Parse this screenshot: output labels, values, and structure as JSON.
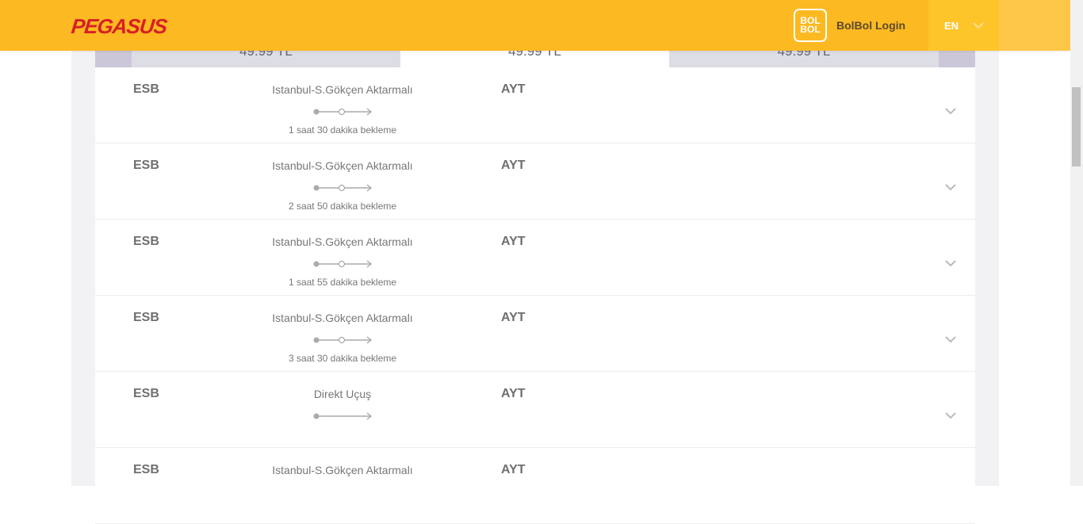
{
  "header": {
    "logo_text": "PEGASUS",
    "bolbol_badge": [
      "BOL",
      "BOL"
    ],
    "bolbol_login": "BolBol Login",
    "language": "EN"
  },
  "price_tabs": [
    {
      "price": "49.99 TL",
      "selected": false
    },
    {
      "price": "49.99 TL",
      "selected": true
    },
    {
      "price": "49.99 TL",
      "selected": false
    }
  ],
  "flights": [
    {
      "from": "ESB",
      "route": "Istanbul-S.Gökçen Aktarmalı",
      "to": "AYT",
      "wait": "1 saat 30 dakika bekleme",
      "stops": 1
    },
    {
      "from": "ESB",
      "route": "Istanbul-S.Gökçen Aktarmalı",
      "to": "AYT",
      "wait": "2 saat 50 dakika bekleme",
      "stops": 1
    },
    {
      "from": "ESB",
      "route": "Istanbul-S.Gökçen Aktarmalı",
      "to": "AYT",
      "wait": "1 saat 55 dakika bekleme",
      "stops": 1
    },
    {
      "from": "ESB",
      "route": "Istanbul-S.Gökçen Aktarmalı",
      "to": "AYT",
      "wait": "3 saat 30 dakika bekleme",
      "stops": 1
    },
    {
      "from": "ESB",
      "route": "Direkt Uçuş",
      "to": "AYT",
      "wait": "",
      "stops": 0
    },
    {
      "from": "ESB",
      "route": "Istanbul-S.Gökçen Aktarmalı",
      "to": "AYT",
      "wait": "",
      "stops": 1
    }
  ],
  "colors": {
    "brand_yellow": "#fdb922",
    "logo_red": "#d71f26",
    "text_gray": "#777777"
  },
  "icons": {
    "expand": "chevron-down-icon",
    "language": "chevron-down-icon",
    "route": "route-line-icon"
  }
}
